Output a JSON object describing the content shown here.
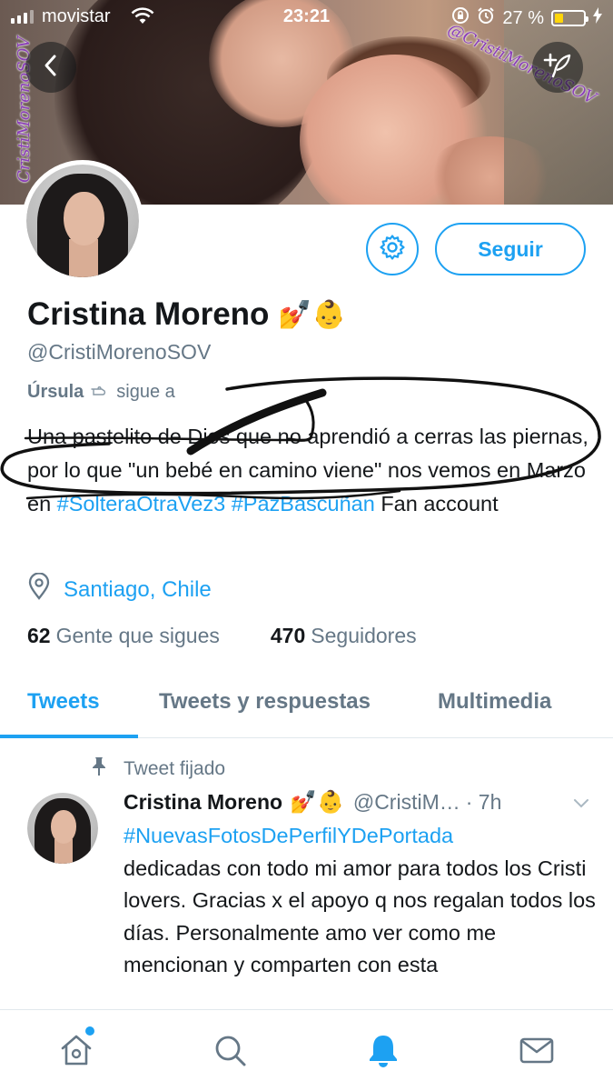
{
  "status_bar": {
    "carrier": "movistar",
    "time": "23:21",
    "battery": "27 %",
    "battery_level": 0.27
  },
  "cover": {
    "watermark": "@CristiMorenoSOV",
    "watermark_left": "CristiMorenoSOV"
  },
  "profile": {
    "name": "Cristina Moreno",
    "name_emojis": "💅👶",
    "handle": "@CristiMorenoSOV",
    "follows_you_name": "Úrsula",
    "follows_you_text": "sigue a",
    "bio_text": "Una pastelito de Dios que no aprendió a cerras las piernas, por lo que \"un bebé en camino viene\" nos vemos en Marzo en",
    "bio_tag1": "#SolteraOtraVez3",
    "bio_tag2": "#PazBascuñan",
    "bio_tail": "Fan account",
    "location": "Santiago, Chile",
    "following_count": "62",
    "following_label": "Gente que sigues",
    "followers_count": "470",
    "followers_label": "Seguidores",
    "follow_button": "Seguir"
  },
  "tabs": [
    {
      "label": "Tweets",
      "active": true
    },
    {
      "label": "Tweets y respuestas",
      "active": false
    },
    {
      "label": "Multimedia",
      "active": false
    }
  ],
  "pinned_tweet": {
    "pinned_label": "Tweet fijado",
    "author": "Cristina Moreno",
    "author_emojis": "💅👶",
    "handle": "@CristiM…",
    "time": "· 7h",
    "hashtag": "#NuevasFotosDePerfilYDePortada",
    "text": "dedicadas con todo mi amor para todos los Cristi lovers. Gracias x el apoyo q nos regalan todos los días. Personalmente amo ver como me mencionan y comparten con esta"
  },
  "colors": {
    "accent": "#1da1f2",
    "secondary_text": "#657786",
    "primary_text": "#14171a"
  },
  "icons": {
    "back": "chevron-left-icon",
    "compose": "add-feather-icon",
    "settings": "gear-icon",
    "location": "location-pin-icon",
    "pin": "pin-icon",
    "home": "home-icon",
    "search": "search-icon",
    "notifications": "bell-icon",
    "messages": "mail-icon"
  }
}
